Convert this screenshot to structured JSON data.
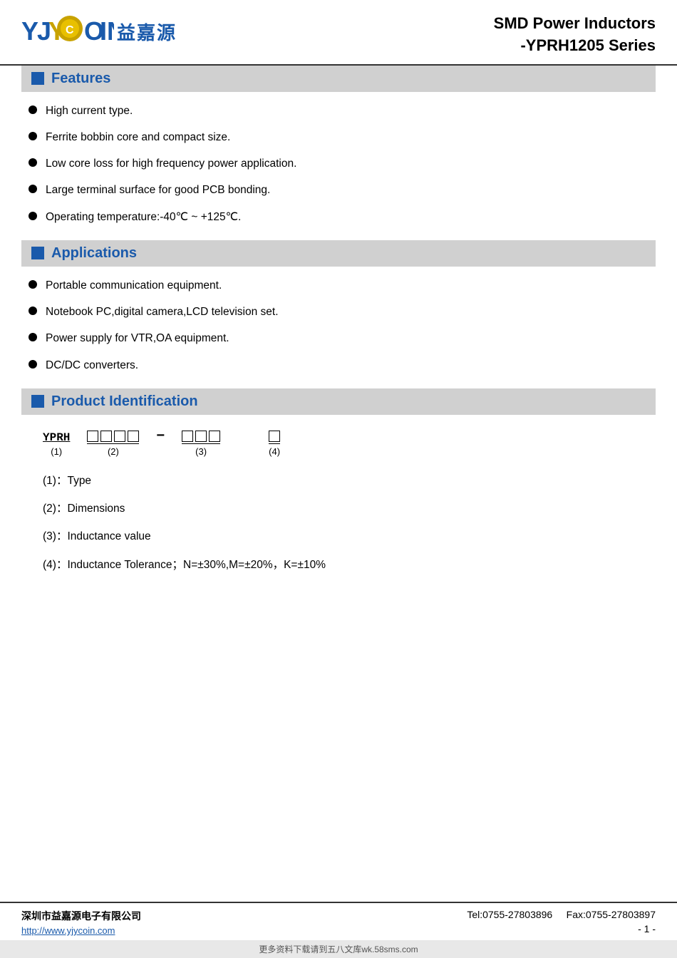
{
  "header": {
    "logo_text": "YJYCOIN",
    "logo_cn": "益嘉源",
    "title_line1": "SMD Power Inductors",
    "title_line2": "-YPRH1205 Series"
  },
  "sections": {
    "features": {
      "label": "Features",
      "items": [
        "High current type.",
        "Ferrite bobbin core and compact size.",
        "Low core loss for high frequency power application.",
        "Large terminal surface for good PCB bonding.",
        "Operating temperature:-40℃  ~ +125℃."
      ]
    },
    "applications": {
      "label": "Applications",
      "items": [
        "Portable communication equipment.",
        "Notebook PC,digital camera,LCD television set.",
        "Power supply for VTR,OA equipment.",
        "DC/DC converters."
      ]
    },
    "product_id": {
      "label": "Product Identification",
      "code_prefix": "YPRH",
      "prefix_num": "(1)",
      "boxes_group2": 4,
      "group2_num": "(2)",
      "boxes_group3": 3,
      "group3_num": "(3)",
      "boxes_group4": 1,
      "group4_num": "(4)",
      "details": [
        {
          "num": "(1)",
          "desc": "Type"
        },
        {
          "num": "(2)",
          "desc": "Dimensions"
        },
        {
          "num": "(3)",
          "desc": "Inductance value"
        },
        {
          "num": "(4)",
          "desc": "Inductance Tolerance；N=±30%,M=±20%，K=±10%"
        }
      ]
    }
  },
  "footer": {
    "company_cn": "深圳市益嘉源电子有限公司",
    "url": "http://www.yjycoin.com",
    "tel": "Tel:0755-27803896",
    "fax": "Fax:0755-27803897",
    "page": "- 1 -"
  },
  "watermark": "更多资料下载请到五八文库wk.58sms.com"
}
